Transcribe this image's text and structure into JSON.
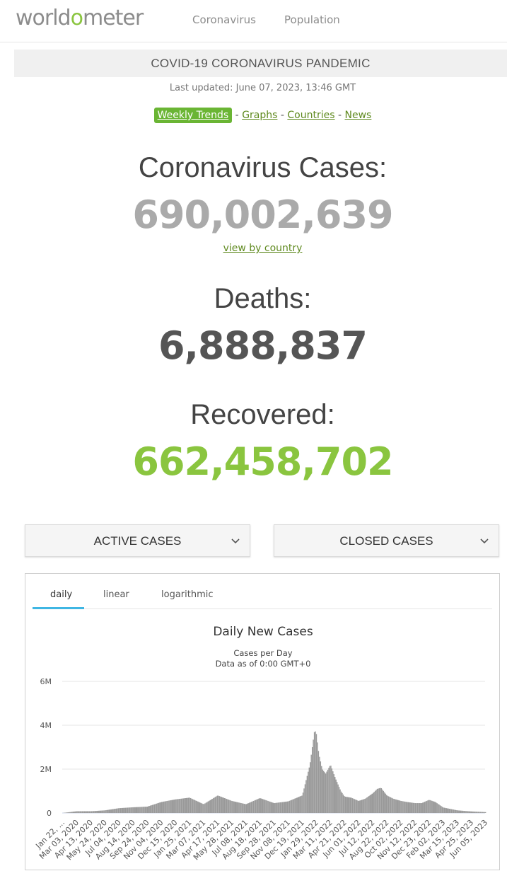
{
  "navbar": {
    "logo_prefix": "world",
    "logo_o": "o",
    "logo_suffix": "meter",
    "links": [
      "Coronavirus",
      "Population"
    ]
  },
  "banner": "COVID-19 CORONAVIRUS PANDEMIC",
  "last_updated": "Last updated: June 07, 2023, 13:46 GMT",
  "quick_links": {
    "weekly": "Weekly Trends",
    "graphs": "Graphs",
    "countries": "Countries",
    "news": "News",
    "sep": "-"
  },
  "counters": {
    "cases_label": "Coronavirus Cases:",
    "cases_value": "690,002,639",
    "view_by_country": "view by country",
    "deaths_label": "Deaths:",
    "deaths_value": "6,888,837",
    "recovered_label": "Recovered:",
    "recovered_value": "662,458,702"
  },
  "panels": {
    "active": "ACTIVE CASES",
    "closed": "CLOSED CASES"
  },
  "chart_tabs": [
    "daily",
    "linear",
    "logarithmic"
  ],
  "colors": {
    "accent_green": "#8ac53f",
    "link_green": "#5f8a1f",
    "bar_gray": "#999999",
    "tab_blue": "#3fb6e3"
  },
  "chart_data": {
    "type": "bar",
    "title": "Daily New Cases",
    "subtitle_lines": [
      "Cases per Day",
      "Data as of 0:00 GMT+0"
    ],
    "xlabel": "",
    "ylabel": "",
    "ylim": [
      0,
      6000000
    ],
    "y_ticks": [
      0,
      2000000,
      4000000,
      6000000
    ],
    "y_tick_labels": [
      "0",
      "2M",
      "4M",
      "6M"
    ],
    "grid": true,
    "x_tick_labels": [
      "Jan 22, ...",
      "Mar 03, 2020",
      "Apr 13, 2020",
      "May 24, 2020",
      "Jul 04, 2020",
      "Aug 14, 2020",
      "Sep 24, 2020",
      "Nov 04, 2020",
      "Dec 15, 2020",
      "Jan 25, 2021",
      "Mar 07, 2021",
      "Apr 17, 2021",
      "May 28, 2021",
      "Jul 08, 2021",
      "Aug 18, 2021",
      "Sep 28, 2021",
      "Nov 08, 2021",
      "Dec 19, 2021",
      "Jan 29, 2022",
      "Mar 11, 2022",
      "Apr 21, 2022",
      "Jun 01, 2022",
      "Jul 12, 2022",
      "Aug 22, 2022",
      "Oct 02, 2022",
      "Nov 12, 2022",
      "Dec 23, 2022",
      "Feb 02, 2023",
      "Mar 15, 2023",
      "Apr 25, 2023",
      "Jun 05, 2023"
    ],
    "x": [
      "2020-01-22",
      "2020-03-03",
      "2020-04-13",
      "2020-05-24",
      "2020-07-04",
      "2020-08-14",
      "2020-09-24",
      "2020-11-04",
      "2020-12-15",
      "2021-01-25",
      "2021-03-07",
      "2021-04-17",
      "2021-05-28",
      "2021-07-08",
      "2021-08-18",
      "2021-09-28",
      "2021-11-08",
      "2021-12-19",
      "2022-01-10",
      "2022-01-17",
      "2022-01-24",
      "2022-01-29",
      "2022-02-05",
      "2022-02-15",
      "2022-02-25",
      "2022-03-11",
      "2022-03-25",
      "2022-04-10",
      "2022-04-21",
      "2022-05-10",
      "2022-06-01",
      "2022-06-20",
      "2022-07-12",
      "2022-07-25",
      "2022-08-05",
      "2022-08-22",
      "2022-09-10",
      "2022-10-02",
      "2022-10-20",
      "2022-11-12",
      "2022-12-01",
      "2022-12-23",
      "2023-01-10",
      "2023-02-02",
      "2023-03-15",
      "2023-04-25",
      "2023-06-05"
    ],
    "values": [
      100,
      80000,
      80000,
      120000,
      220000,
      260000,
      290000,
      500000,
      620000,
      700000,
      400000,
      800000,
      550000,
      400000,
      680000,
      450000,
      530000,
      800000,
      2200000,
      3000000,
      3800000,
      3600000,
      2700000,
      2000000,
      1800000,
      2200000,
      1600000,
      1000000,
      750000,
      700000,
      550000,
      650000,
      900000,
      1100000,
      1150000,
      800000,
      650000,
      550000,
      500000,
      450000,
      450000,
      600000,
      500000,
      250000,
      120000,
      70000,
      40000
    ]
  }
}
